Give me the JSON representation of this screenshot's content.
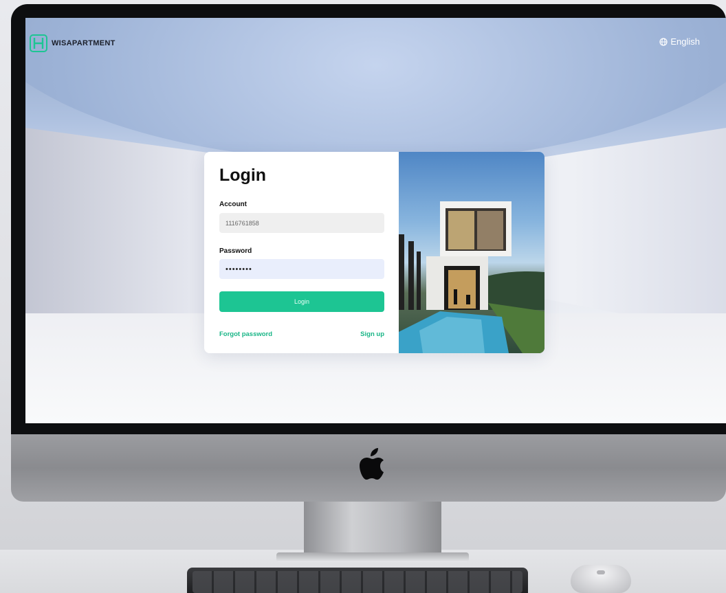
{
  "brand": {
    "name": "WISAPARTMENT",
    "accent": "#1dc593"
  },
  "header": {
    "language_label": "English",
    "language_icon": "globe-icon"
  },
  "login": {
    "title": "Login",
    "account_label": "Account",
    "account_value": "1116761858",
    "password_label": "Password",
    "password_value": "••••••••",
    "submit_label": "Login",
    "forgot_label": "Forgot password",
    "signup_label": "Sign up"
  },
  "device": {
    "logo_icon": "apple-icon"
  }
}
